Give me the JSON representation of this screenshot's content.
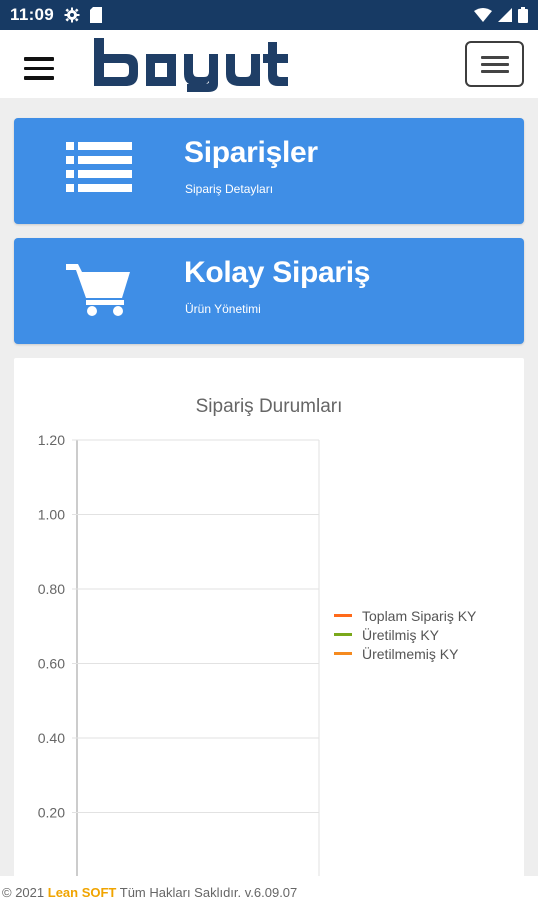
{
  "status_bar": {
    "time": "11:09",
    "icons": [
      "settings-icon",
      "sim-card-icon",
      "wifi-icon",
      "signal-icon",
      "battery-icon"
    ]
  },
  "app_bar": {
    "logo_text": "boyut",
    "logo_color": "#1f3e66",
    "menu_icon": "hamburger-icon"
  },
  "cards": [
    {
      "title": "Siparişler",
      "subtitle": "Sipariş Detayları",
      "icon": "list-icon",
      "color": "#3f8ee6"
    },
    {
      "title": "Kolay Sipariş",
      "subtitle": "Ürün Yönetimi",
      "icon": "shopping-cart-icon",
      "color": "#3f8ee6"
    }
  ],
  "chart_data": {
    "type": "bar",
    "title": "Sipariş Durumları",
    "categories": [],
    "series": [
      {
        "name": "Toplam Sipariş KY",
        "color": "#ff6a1a",
        "values": []
      },
      {
        "name": "Üretilmiş KY",
        "color": "#7aa81b",
        "values": []
      },
      {
        "name": "Üretilmemiş KY",
        "color": "#f58a1f",
        "values": []
      }
    ],
    "y_ticks": [
      "1.20",
      "1.00",
      "0.80",
      "0.60",
      "0.40",
      "0.20"
    ],
    "ylim": [
      0,
      1.2
    ],
    "grid": true,
    "legend_position": "right"
  },
  "footer": {
    "prefix": "© 2021",
    "brand": "Lean SOFT",
    "suffix": "Tüm Hakları Saklıdır. v.6.09.07"
  }
}
